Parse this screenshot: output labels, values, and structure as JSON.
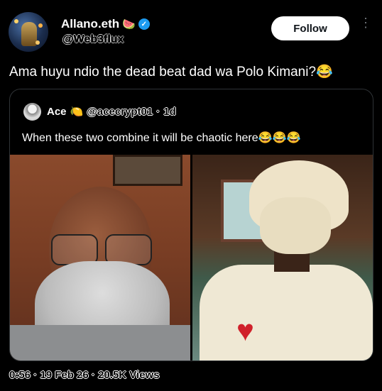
{
  "author": {
    "name": "Allano.eth",
    "name_emoji": "🍉",
    "verified_mark": "✓",
    "handle": "@Web3flux"
  },
  "follow_label": "Follow",
  "more_glyph": "⋮",
  "tweet_text": "Ama huyu ndio the dead beat dad wa Polo Kimani?😂",
  "quote": {
    "name": "Ace",
    "name_emoji": "🍋",
    "handle": "@acecrypt01",
    "separator": "·",
    "age": "1d",
    "text": "When these two combine it will be chaotic here😂😂😂"
  },
  "footer": {
    "time": "0:56",
    "separator": "·",
    "date": "19 Feb 26",
    "views": "20.5K Views"
  },
  "colors": {
    "background": "#000000",
    "text": "#e7e9ea",
    "verified": "#1d9bf0",
    "follow_bg": "#ffffff"
  },
  "icons": {
    "verified": "verified-badge-icon",
    "more": "more-dots-icon"
  }
}
